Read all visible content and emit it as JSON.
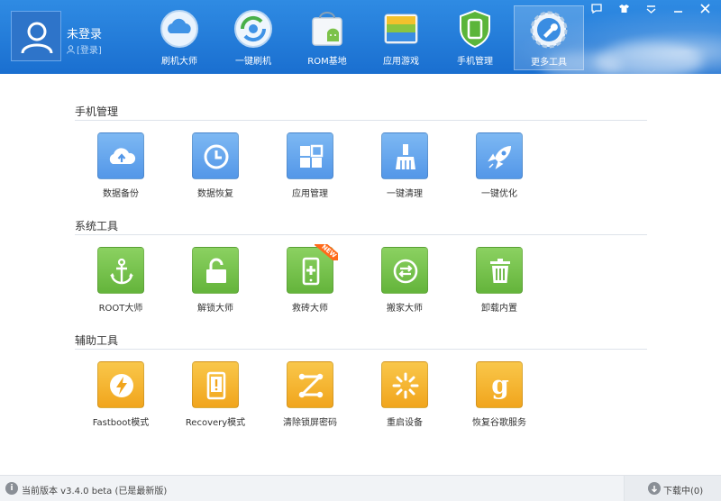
{
  "header": {
    "user_name": "未登录",
    "login_link": "[登录]",
    "nav": [
      {
        "label": "刷机大师",
        "icon": "cloud-icon"
      },
      {
        "label": "一键刷机",
        "icon": "refresh-disc-icon"
      },
      {
        "label": "ROM基地",
        "icon": "android-bag-icon"
      },
      {
        "label": "应用游戏",
        "icon": "app-stack-icon"
      },
      {
        "label": "手机管理",
        "icon": "phone-shield-icon"
      },
      {
        "label": "更多工具",
        "icon": "wrench-gear-icon",
        "active": true
      }
    ],
    "window_controls": [
      "message-icon",
      "skin-icon",
      "menu-icon",
      "minimize-icon",
      "close-icon"
    ]
  },
  "sections": [
    {
      "title": "手机管理",
      "tools": [
        {
          "label": "数据备份",
          "icon": "cloud-upload-icon",
          "color": "blue"
        },
        {
          "label": "数据恢复",
          "icon": "clock-icon",
          "color": "blue"
        },
        {
          "label": "应用管理",
          "icon": "grid-icon",
          "color": "blue"
        },
        {
          "label": "一键清理",
          "icon": "broom-icon",
          "color": "blue"
        },
        {
          "label": "一键优化",
          "icon": "rocket-icon",
          "color": "blue"
        }
      ]
    },
    {
      "title": "系统工具",
      "tools": [
        {
          "label": "ROOT大师",
          "icon": "anchor-icon",
          "color": "green"
        },
        {
          "label": "解锁大师",
          "icon": "unlock-icon",
          "color": "green"
        },
        {
          "label": "救砖大师",
          "icon": "phone-plus-icon",
          "color": "green",
          "badge": "NEW"
        },
        {
          "label": "搬家大师",
          "icon": "transfer-icon",
          "color": "green"
        },
        {
          "label": "卸载内置",
          "icon": "trash-icon",
          "color": "green"
        }
      ]
    },
    {
      "title": "辅助工具",
      "tools": [
        {
          "label": "Fastboot模式",
          "icon": "lightning-icon",
          "color": "orange"
        },
        {
          "label": "Recovery模式",
          "icon": "phone-alert-icon",
          "color": "orange"
        },
        {
          "label": "清除锁屏密码",
          "icon": "pattern-lock-icon",
          "color": "orange"
        },
        {
          "label": "重启设备",
          "icon": "spinner-icon",
          "color": "orange"
        },
        {
          "label": "恢复谷歌服务",
          "icon": "google-g-icon",
          "color": "orange"
        }
      ]
    }
  ],
  "status": {
    "version": "当前版本 v3.4.0 beta (已是最新版)",
    "download": "下载中(0)"
  },
  "colors": {
    "header": "#1f7ad8",
    "blue": "#5b9de9",
    "green": "#6cbb43",
    "orange": "#f3ae2a"
  }
}
